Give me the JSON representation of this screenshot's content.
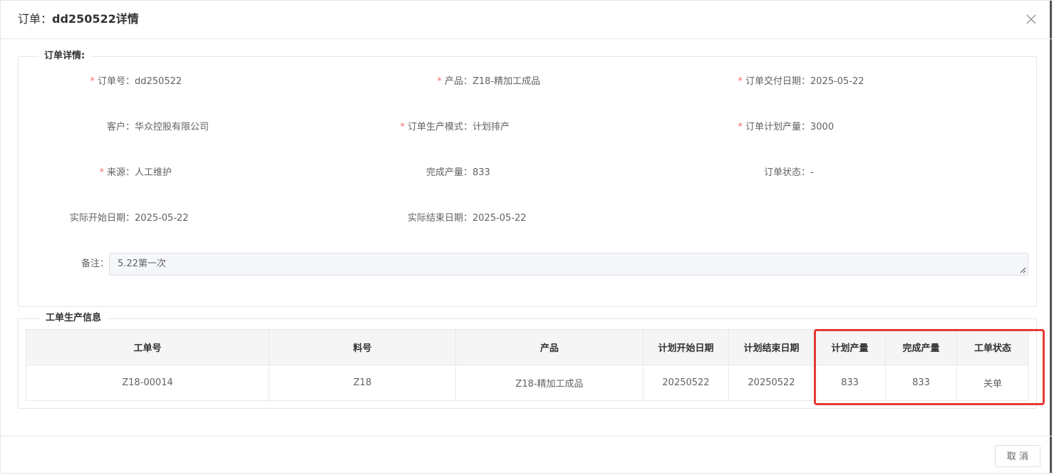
{
  "dialog": {
    "title_prefix": "订单：",
    "title_order": "dd250522",
    "title_suffix": "详情"
  },
  "order_details": {
    "legend": "订单详情:",
    "fields": {
      "order_no": {
        "label": "订单号：",
        "value": "dd250522",
        "required": true
      },
      "product": {
        "label": "产品：",
        "value": "Z18-精加工成品",
        "required": true
      },
      "delivery_date": {
        "label": "订单交付日期：",
        "value": "2025-05-22",
        "required": true
      },
      "customer": {
        "label": "客户：",
        "value": "华众控股有限公司",
        "required": false
      },
      "production_mode": {
        "label": "订单生产模式：",
        "value": "计划排产",
        "required": true
      },
      "planned_qty": {
        "label": "订单计划产量：",
        "value": "3000",
        "required": true
      },
      "source": {
        "label": "来源：",
        "value": "人工维护",
        "required": true
      },
      "completed_qty": {
        "label": "完成产量：",
        "value": "833",
        "required": false
      },
      "order_status": {
        "label": "订单状态：",
        "value": "-",
        "required": false
      },
      "actual_start": {
        "label": "实际开始日期：",
        "value": "2025-05-22",
        "required": false
      },
      "actual_end": {
        "label": "实际结束日期：",
        "value": "2025-05-22",
        "required": false
      },
      "remark": {
        "label": "备注：",
        "value": "5.22第一次",
        "required": false
      }
    },
    "required_mark": "*"
  },
  "work_orders": {
    "legend": "工单生产信息",
    "columns": [
      "工单号",
      "料号",
      "产品",
      "计划开始日期",
      "计划结束日期",
      "计划产量",
      "完成产量",
      "工单状态"
    ],
    "rows": [
      [
        "Z18-00014",
        "Z18",
        "Z18-精加工成品",
        "20250522",
        "20250522",
        "833",
        "833",
        "关单"
      ]
    ]
  },
  "footer": {
    "cancel_label": "取 消"
  },
  "colors": {
    "required": "#f56c6c",
    "highlight": "#e53935"
  },
  "icons": {
    "close": "close-icon",
    "resize": "resize-grip-icon"
  }
}
